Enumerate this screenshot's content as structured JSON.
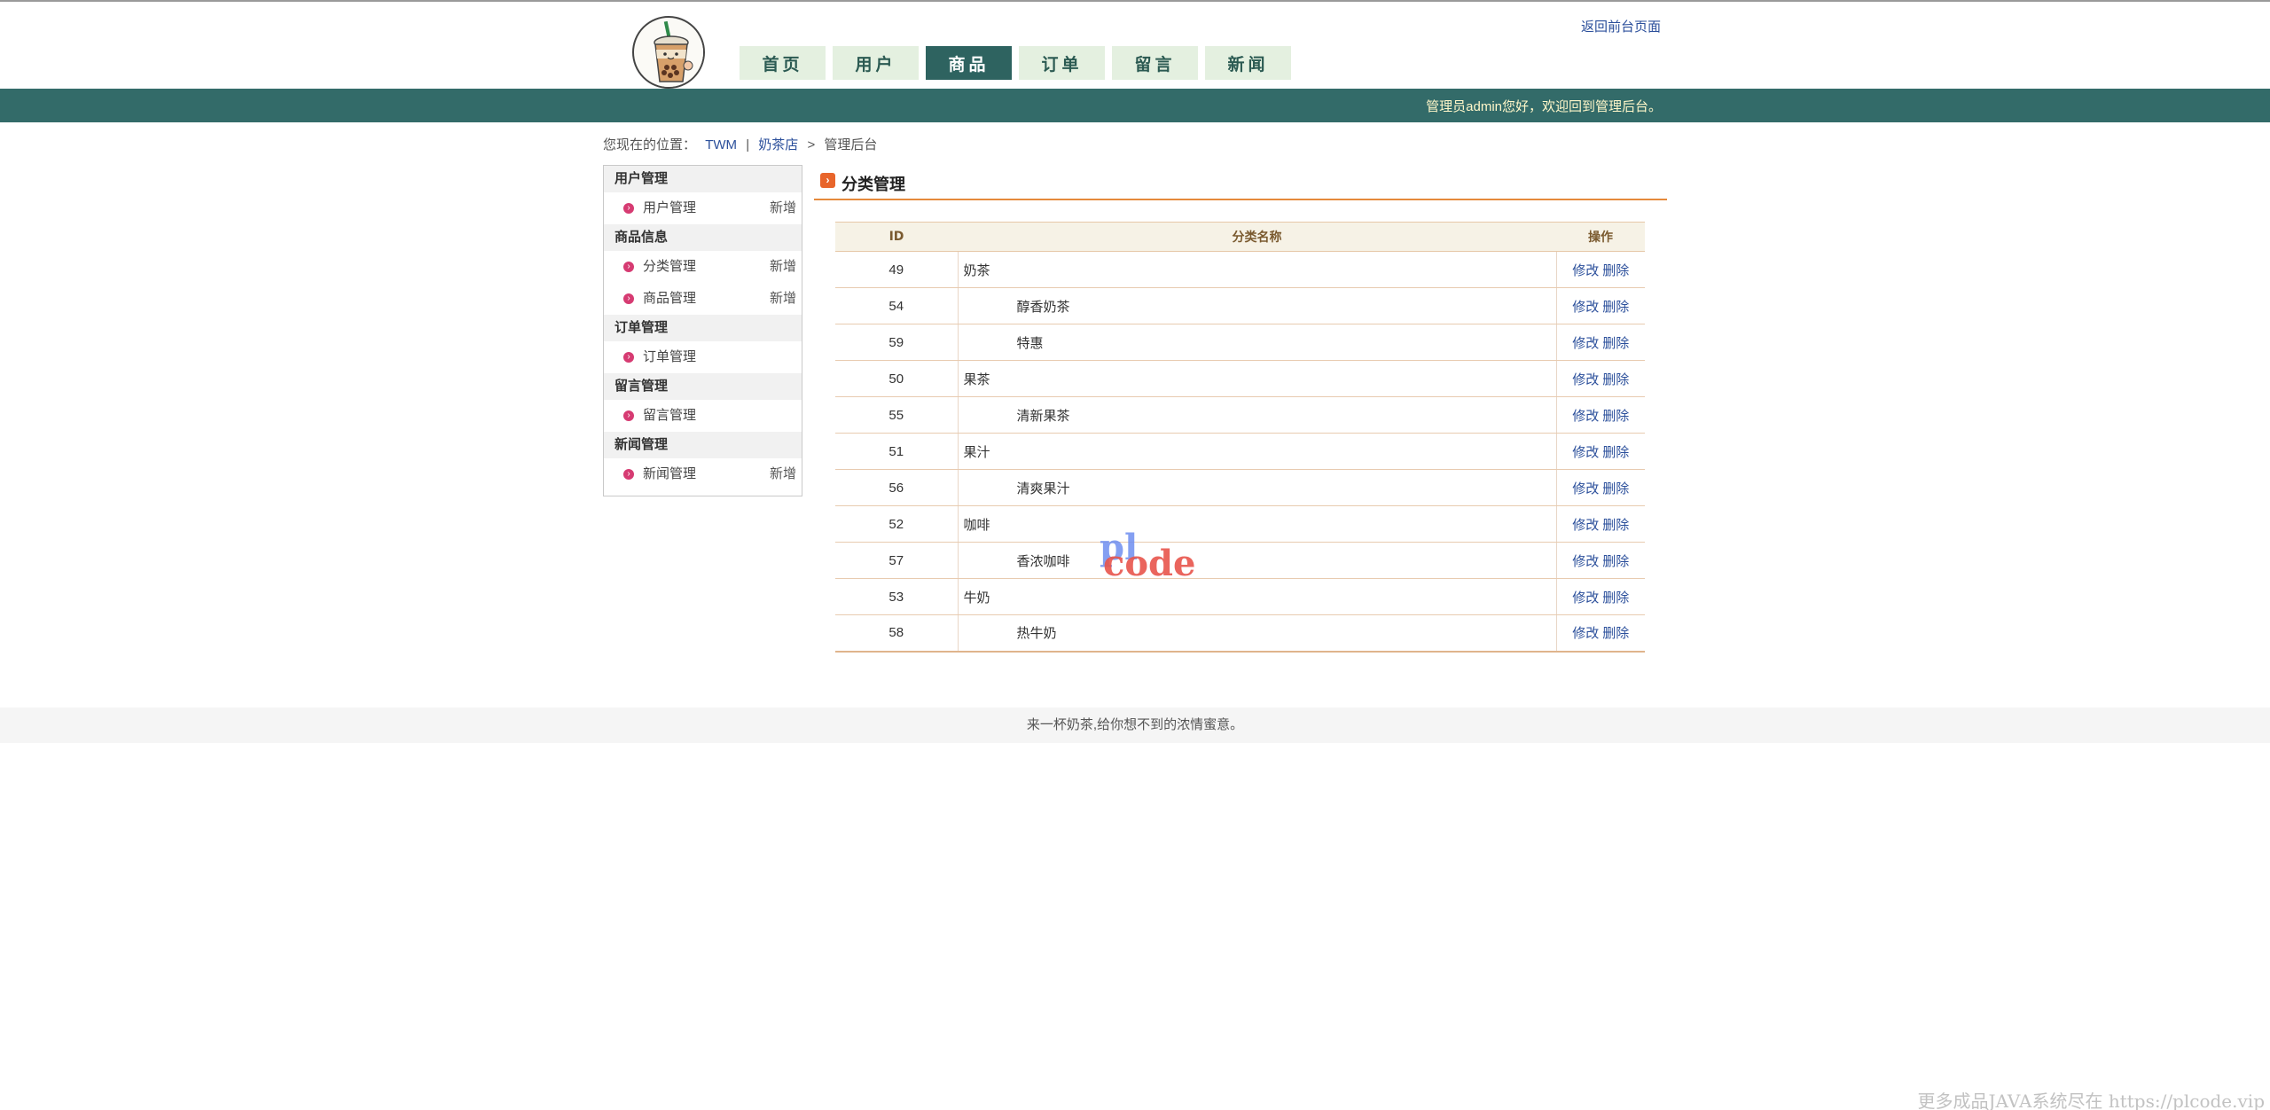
{
  "header": {
    "back_link": "返回前台页面",
    "nav": [
      {
        "label": "首页",
        "active": false
      },
      {
        "label": "用户",
        "active": false
      },
      {
        "label": "商品",
        "active": true
      },
      {
        "label": "订单",
        "active": false
      },
      {
        "label": "留言",
        "active": false
      },
      {
        "label": "新闻",
        "active": false
      }
    ]
  },
  "greenbar": {
    "greeting": "管理员admin您好，欢迎回到管理后台。"
  },
  "breadcrumb": {
    "prefix": "您现在的位置：",
    "items": [
      "TWM",
      "奶茶店"
    ],
    "divider": "|",
    "arrow": ">",
    "current": "管理后台"
  },
  "sidebar": {
    "groups": [
      {
        "title": "用户管理",
        "items": [
          {
            "label": "用户管理",
            "add": "新增"
          }
        ]
      },
      {
        "title": "商品信息",
        "items": [
          {
            "label": "分类管理",
            "add": "新增"
          },
          {
            "label": "商品管理",
            "add": "新增"
          }
        ]
      },
      {
        "title": "订单管理",
        "items": [
          {
            "label": "订单管理",
            "add": ""
          }
        ]
      },
      {
        "title": "留言管理",
        "items": [
          {
            "label": "留言管理",
            "add": ""
          }
        ]
      },
      {
        "title": "新闻管理",
        "items": [
          {
            "label": "新闻管理",
            "add": "新增"
          }
        ]
      }
    ]
  },
  "main": {
    "title": "分类管理",
    "table": {
      "headers": [
        "ID",
        "分类名称",
        "操作"
      ],
      "edit_label": "修改",
      "delete_label": "删除",
      "rows": [
        {
          "id": "49",
          "name": "奶茶",
          "child": false
        },
        {
          "id": "54",
          "name": "醇香奶茶",
          "child": true
        },
        {
          "id": "59",
          "name": "特惠",
          "child": true
        },
        {
          "id": "50",
          "name": "果茶",
          "child": false
        },
        {
          "id": "55",
          "name": "清新果茶",
          "child": true
        },
        {
          "id": "51",
          "name": "果汁",
          "child": false
        },
        {
          "id": "56",
          "name": "清爽果汁",
          "child": true
        },
        {
          "id": "52",
          "name": "咖啡",
          "child": false
        },
        {
          "id": "57",
          "name": "香浓咖啡",
          "child": true
        },
        {
          "id": "53",
          "name": "牛奶",
          "child": false
        },
        {
          "id": "58",
          "name": "热牛奶",
          "child": true
        }
      ]
    }
  },
  "watermark": {
    "line1": "pl",
    "line2": "code"
  },
  "footer": {
    "text": "来一杯奶茶,给你想不到的浓情蜜意。"
  },
  "corner_note": "更多成品JAVA系统尽在 https://plcode.vip",
  "icons": {
    "logo": "milk-tea-cup-logo",
    "title": "arrow-right-icon",
    "bullet": "arrow-bullet-icon"
  },
  "colors": {
    "primary_green": "#336b69",
    "nav_active": "#2e6360",
    "nav_bg": "#e4f0e0",
    "link": "#2b4f9b",
    "accent_orange": "#e58a3c",
    "bullet": "#d63b72",
    "greeting": "#fff7c9"
  }
}
